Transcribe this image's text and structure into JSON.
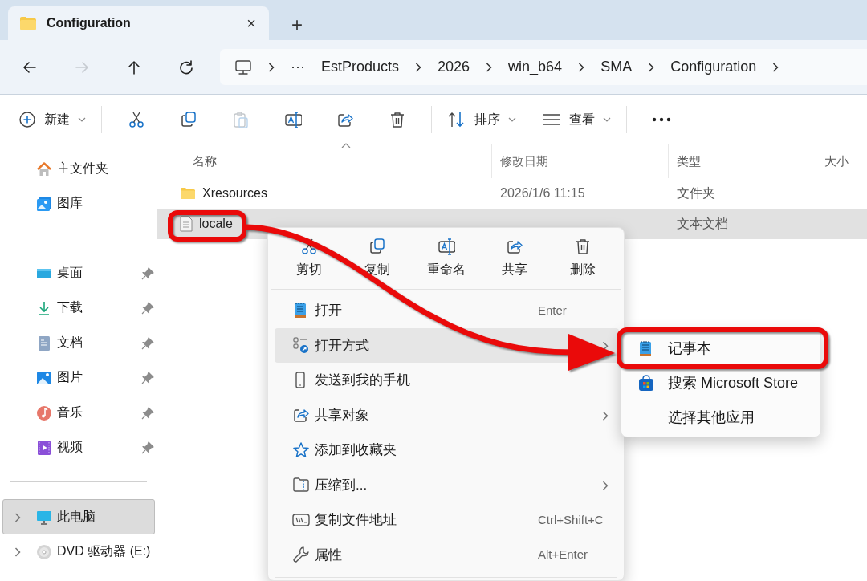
{
  "window": {
    "tab_title": "Configuration",
    "tab_close": "×",
    "new_tab": "+"
  },
  "nav_buttons": [
    {
      "disabled": false
    },
    {
      "disabled": true
    },
    {
      "disabled": false
    },
    {
      "disabled": false
    }
  ],
  "breadcrumb": {
    "overflow": "···",
    "items": [
      "EstProducts",
      "2026",
      "win_b64",
      "SMA",
      "Configuration"
    ]
  },
  "toolbar": {
    "new": {
      "label": "新建",
      "dropdown": true
    },
    "actions": [
      {
        "disabled": false
      },
      {
        "disabled": false
      },
      {
        "disabled": true
      },
      {
        "disabled": false
      },
      {
        "disabled": false
      },
      {
        "disabled": false
      }
    ],
    "sort": {
      "label": "排序",
      "dropdown": true
    },
    "view": {
      "label": "查看",
      "dropdown": true
    }
  },
  "sidebar": {
    "groups": [
      [
        {
          "label": "主文件夹",
          "pinned": false,
          "expandable": false,
          "selected": false
        },
        {
          "label": "图库",
          "pinned": false,
          "expandable": false,
          "selected": false
        }
      ],
      [
        {
          "label": "桌面",
          "pinned": true,
          "expandable": false,
          "selected": false
        },
        {
          "label": "下载",
          "pinned": true,
          "expandable": false,
          "selected": false
        },
        {
          "label": "文档",
          "pinned": true,
          "expandable": false,
          "selected": false
        },
        {
          "label": "图片",
          "pinned": true,
          "expandable": false,
          "selected": false
        },
        {
          "label": "音乐",
          "pinned": true,
          "expandable": false,
          "selected": false
        },
        {
          "label": "视频",
          "pinned": true,
          "expandable": false,
          "selected": false
        }
      ],
      [
        {
          "label": "此电脑",
          "pinned": false,
          "expandable": true,
          "selected": true
        },
        {
          "label": "DVD 驱动器 (E:)",
          "pinned": false,
          "expandable": true,
          "selected": false
        }
      ]
    ]
  },
  "file_list": {
    "columns": [
      {
        "label": "名称",
        "sorted": true
      },
      {
        "label": "修改日期",
        "sorted": false
      },
      {
        "label": "类型",
        "sorted": false
      },
      {
        "label": "大小",
        "sorted": false
      }
    ],
    "rows": [
      {
        "name": "Xresources",
        "kind": "folder",
        "modified": "2026/1/6 11:15",
        "type": "文件夹",
        "selected": false
      },
      {
        "name": "locale",
        "kind": "text",
        "type": "文本文档",
        "selected": true
      }
    ]
  },
  "context_menu": {
    "quick_actions": [
      "剪切",
      "复制",
      "重命名",
      "共享",
      "删除"
    ],
    "items": [
      {
        "label": "打开",
        "shortcut": "Enter",
        "submenu": false,
        "highlighted": false
      },
      {
        "label": "打开方式",
        "submenu": true,
        "highlighted": true
      },
      {
        "label": "发送到我的手机",
        "submenu": false,
        "highlighted": false
      },
      {
        "label": "共享对象",
        "submenu": true,
        "highlighted": false
      },
      {
        "label": "添加到收藏夹",
        "submenu": false,
        "highlighted": false
      },
      {
        "label": "压缩到...",
        "submenu": true,
        "highlighted": false
      },
      {
        "label": "复制文件地址",
        "shortcut": "Ctrl+Shift+C",
        "submenu": false,
        "highlighted": false
      },
      {
        "label": "属性",
        "shortcut": "Alt+Enter",
        "submenu": false,
        "highlighted": false
      }
    ]
  },
  "submenu": {
    "items": [
      {
        "label": "记事本"
      },
      {
        "label": "搜索 Microsoft Store"
      },
      {
        "label": "选择其他应用"
      }
    ]
  }
}
